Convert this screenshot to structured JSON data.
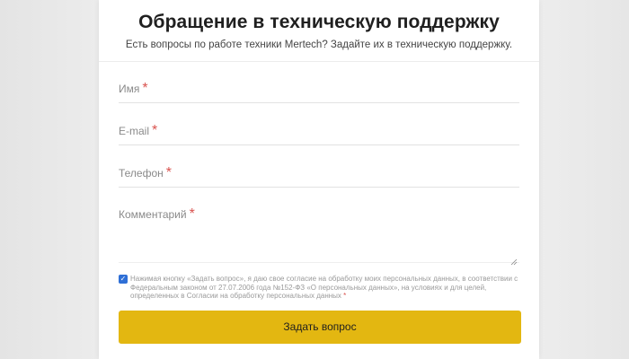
{
  "form": {
    "title": "Обращение в техническую поддержку",
    "subtitle": "Есть вопросы по работе техники Mertech? Задайте их в техническую поддержку.",
    "fields": [
      {
        "label": "Имя",
        "required": "*"
      },
      {
        "label": "E-mail",
        "required": "*"
      },
      {
        "label": "Телефон",
        "required": "*"
      },
      {
        "label": "Комментарий",
        "required": "*"
      }
    ],
    "consent": {
      "checked": true,
      "text": "Нажимая кнопку «Задать вопрос», я даю свое согласие на обработку моих персональных данных, в соответствии с Федеральным законом от 27.07.2006 года №152-ФЗ «О персональных данных», на условиях и для целей, определенных в Согласии на обработку персональных данных",
      "required": "*"
    },
    "submit_label": "Задать вопрос"
  },
  "colors": {
    "accent": "#e3b711",
    "required": "#d9534f",
    "checkbox": "#2f6fd6"
  }
}
